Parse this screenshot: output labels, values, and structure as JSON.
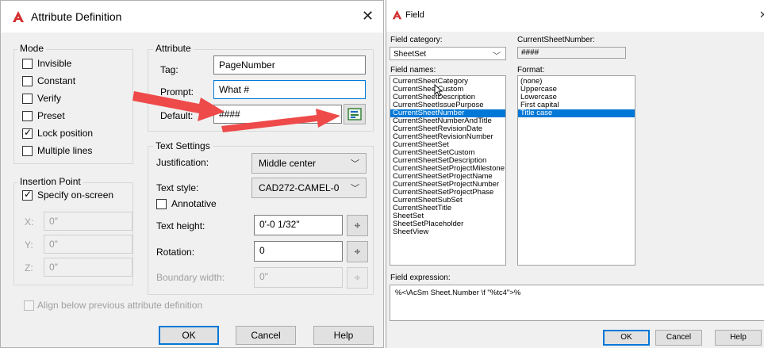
{
  "attr_dialog": {
    "title": "Attribute Definition",
    "close_glyph": "✕",
    "mode": {
      "label": "Mode",
      "options": [
        {
          "label": "Invisible",
          "checked": false
        },
        {
          "label": "Constant",
          "checked": false
        },
        {
          "label": "Verify",
          "checked": false
        },
        {
          "label": "Preset",
          "checked": false
        },
        {
          "label": "Lock position",
          "checked": true
        },
        {
          "label": "Multiple lines",
          "checked": false
        }
      ]
    },
    "attribute": {
      "label": "Attribute",
      "tag_label": "Tag:",
      "tag_value": "PageNumber",
      "prompt_label": "Prompt:",
      "prompt_value": "What #",
      "default_label": "Default:",
      "default_value": "####"
    },
    "insertion_point": {
      "label": "Insertion Point",
      "specify_label": "Specify on-screen",
      "specify_checked": true,
      "x_label": "X:",
      "x_value": "0\"",
      "y_label": "Y:",
      "y_value": "0\"",
      "z_label": "Z:",
      "z_value": "0\""
    },
    "text_settings": {
      "label": "Text Settings",
      "justification_label": "Justification:",
      "justification_value": "Middle center",
      "text_style_label": "Text style:",
      "text_style_value": "CAD272-CAMEL-0",
      "annotative_label": "Annotative",
      "text_height_label": "Text height:",
      "text_height_value": "0'-0 1/32\"",
      "rotation_label": "Rotation:",
      "rotation_value": "0",
      "boundary_width_label": "Boundary width:",
      "boundary_width_value": "0\""
    },
    "align_label": "Align below previous attribute definition",
    "buttons": {
      "ok": "OK",
      "cancel": "Cancel",
      "help": "Help"
    }
  },
  "field_dialog": {
    "title": "Field",
    "close_glyph": "✕",
    "category_label": "Field category:",
    "category_value": "SheetSet",
    "names_label": "Field names:",
    "field_names": [
      "CurrentSheetCategory",
      "CurrentSheetCustom",
      "CurrentSheetDescription",
      "CurrentSheetIssuePurpose",
      "CurrentSheetNumber",
      "CurrentSheetNumberAndTitle",
      "CurrentSheetRevisionDate",
      "CurrentSheetRevisionNumber",
      "CurrentSheetSet",
      "CurrentSheetSetCustom",
      "CurrentSheetSetDescription",
      "CurrentSheetSetProjectMilestone",
      "CurrentSheetSetProjectName",
      "CurrentSheetSetProjectNumber",
      "CurrentSheetSetProjectPhase",
      "CurrentSheetSubSet",
      "CurrentSheetTitle",
      "SheetSet",
      "SheetSetPlaceholder",
      "SheetView"
    ],
    "selected_field_name": "CurrentSheetNumber",
    "current_label": "CurrentSheetNumber:",
    "current_value": "####",
    "format_label": "Format:",
    "formats": [
      "(none)",
      "Uppercase",
      "Lowercase",
      "First capital",
      "Title case"
    ],
    "selected_format": "Title case",
    "expression_label": "Field expression:",
    "expression_value": "%<\\AcSm Sheet.Number \\f \"%tc4\">%",
    "buttons": {
      "ok": "OK",
      "cancel": "Cancel",
      "help": "Help"
    }
  },
  "colors": {
    "accent": "#0078d7",
    "arrow": "#ef4a4a",
    "logo": "#d32f2f"
  },
  "icons": {
    "logo": "autocad-logo-icon",
    "field": "insert-field-icon",
    "pick": "pick-point-icon",
    "arrow": "red-annotation-arrow"
  }
}
